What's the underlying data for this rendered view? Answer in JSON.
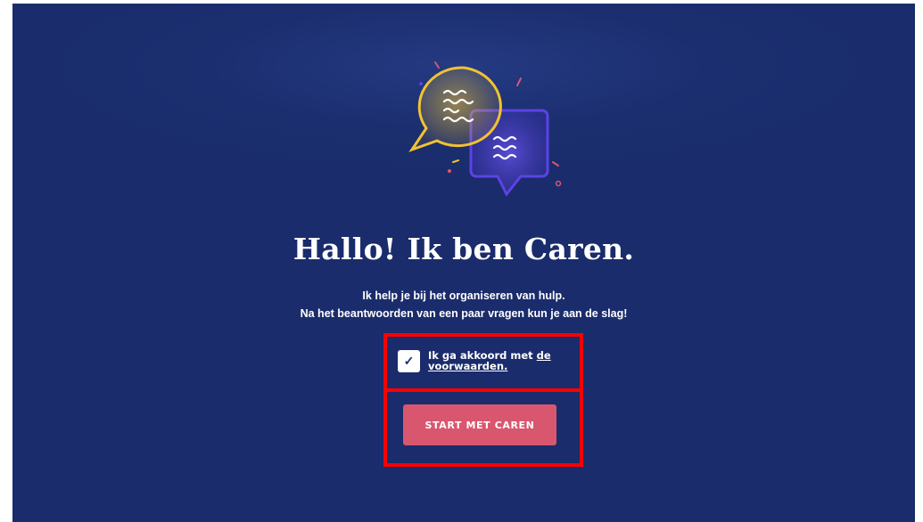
{
  "hero": {
    "headline": "Hallo! Ik ben Caren.",
    "subline_1": "Ik help je bij het organiseren van hulp.",
    "subline_2": "Na het beantwoorden van een paar vragen kun je aan de slag!"
  },
  "consent": {
    "checked": true,
    "checkmark": "✓",
    "text_prefix": "Ik ga akkoord met ",
    "link_text": "de voorwaarden."
  },
  "start_button": {
    "label": "START MET CAREN"
  },
  "colors": {
    "background": "#1b2e6f",
    "accent_button": "#d9566f",
    "bubble_yellow": "#f2c230",
    "bubble_purple": "#5b43e6",
    "highlight": "#ff0000"
  },
  "icons": {
    "illustration": "chat-bubbles-icon",
    "checkbox": "checkmark-icon"
  }
}
